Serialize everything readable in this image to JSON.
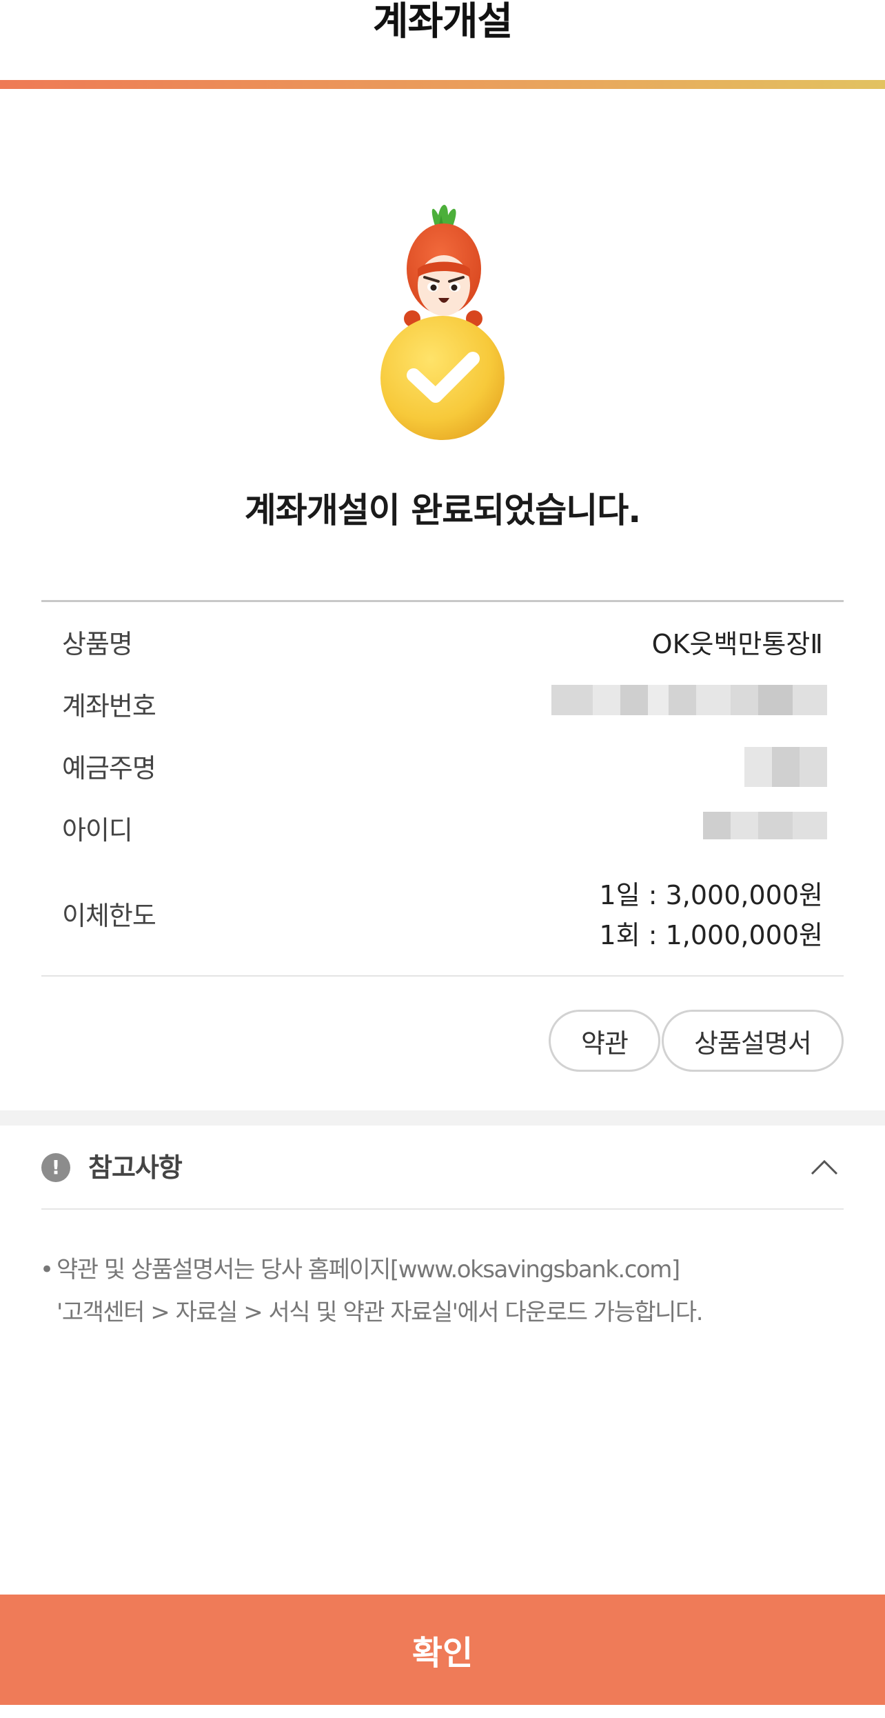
{
  "header": {
    "title": "계좌개설"
  },
  "result": {
    "message": "계좌개설이 완료되었습니다."
  },
  "info": {
    "product": {
      "label": "상품명",
      "value": "OK읏백만통장Ⅱ"
    },
    "account": {
      "label": "계좌번호"
    },
    "holder": {
      "label": "예금주명"
    },
    "user_id": {
      "label": "아이디"
    },
    "limit": {
      "label": "이체한도",
      "daily": "1일 : 3,000,000원",
      "per_transfer": "1회 : 1,000,000원"
    }
  },
  "buttons": {
    "terms": "약관",
    "product_desc": "상품설명서",
    "confirm": "확인"
  },
  "notes": {
    "title": "참고사항",
    "icon": "!",
    "bullet": "•",
    "line1": "약관 및 상품설명서는 당사 홈페이지[www.oksavingsbank.com]",
    "line2": "'고객센터 > 자료실 > 서식 및 약관 자료실'에서 다운로드 가능합니다."
  },
  "colors": {
    "accent": "#ef7b58",
    "bar_start": "#ee7a55",
    "bar_end": "#e2c260"
  }
}
